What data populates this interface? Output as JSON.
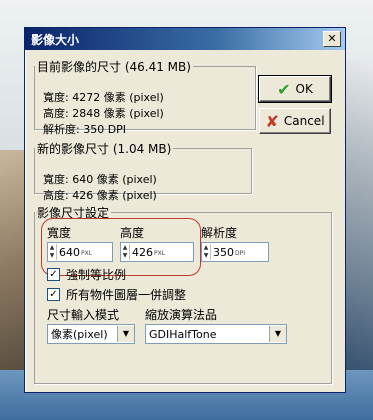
{
  "window": {
    "title": "影像大小",
    "close_icon": "close-icon"
  },
  "current": {
    "legend": "目前影像的尺寸 (46.41 MB)",
    "width": "寬度: 4272 像素 (pixel)",
    "height": "高度: 2848 像素 (pixel)",
    "resolution": "解析度: 350 DPI"
  },
  "new": {
    "legend": "新的影像尺寸 (1.04 MB)",
    "width": "寬度: 640 像素 (pixel)",
    "height": "高度: 426 像素 (pixel)"
  },
  "settings": {
    "legend": "影像尺寸設定",
    "width_label": "寬度",
    "height_label": "高度",
    "res_label": "解析度",
    "width_value": "640",
    "width_unit": "PXL",
    "height_value": "426",
    "height_unit": "PXL",
    "res_value": "350",
    "res_unit": "DPI"
  },
  "options": {
    "keep_ratio": "強制等比例",
    "all_layers": "所有物件圖層一併調整",
    "input_mode_label": "尺寸輸入模式",
    "scale_algo_label": "縮放演算法品",
    "input_mode_value": "像素(pixel)",
    "scale_algo_value": "GDIHalfTone"
  },
  "buttons": {
    "ok": "OK",
    "cancel": "Cancel"
  },
  "colors": {
    "titlebar": "#0a246a",
    "highlight": "#c0392b",
    "ok_check": "#2e9e2e",
    "cancel_x": "#c0392b"
  }
}
